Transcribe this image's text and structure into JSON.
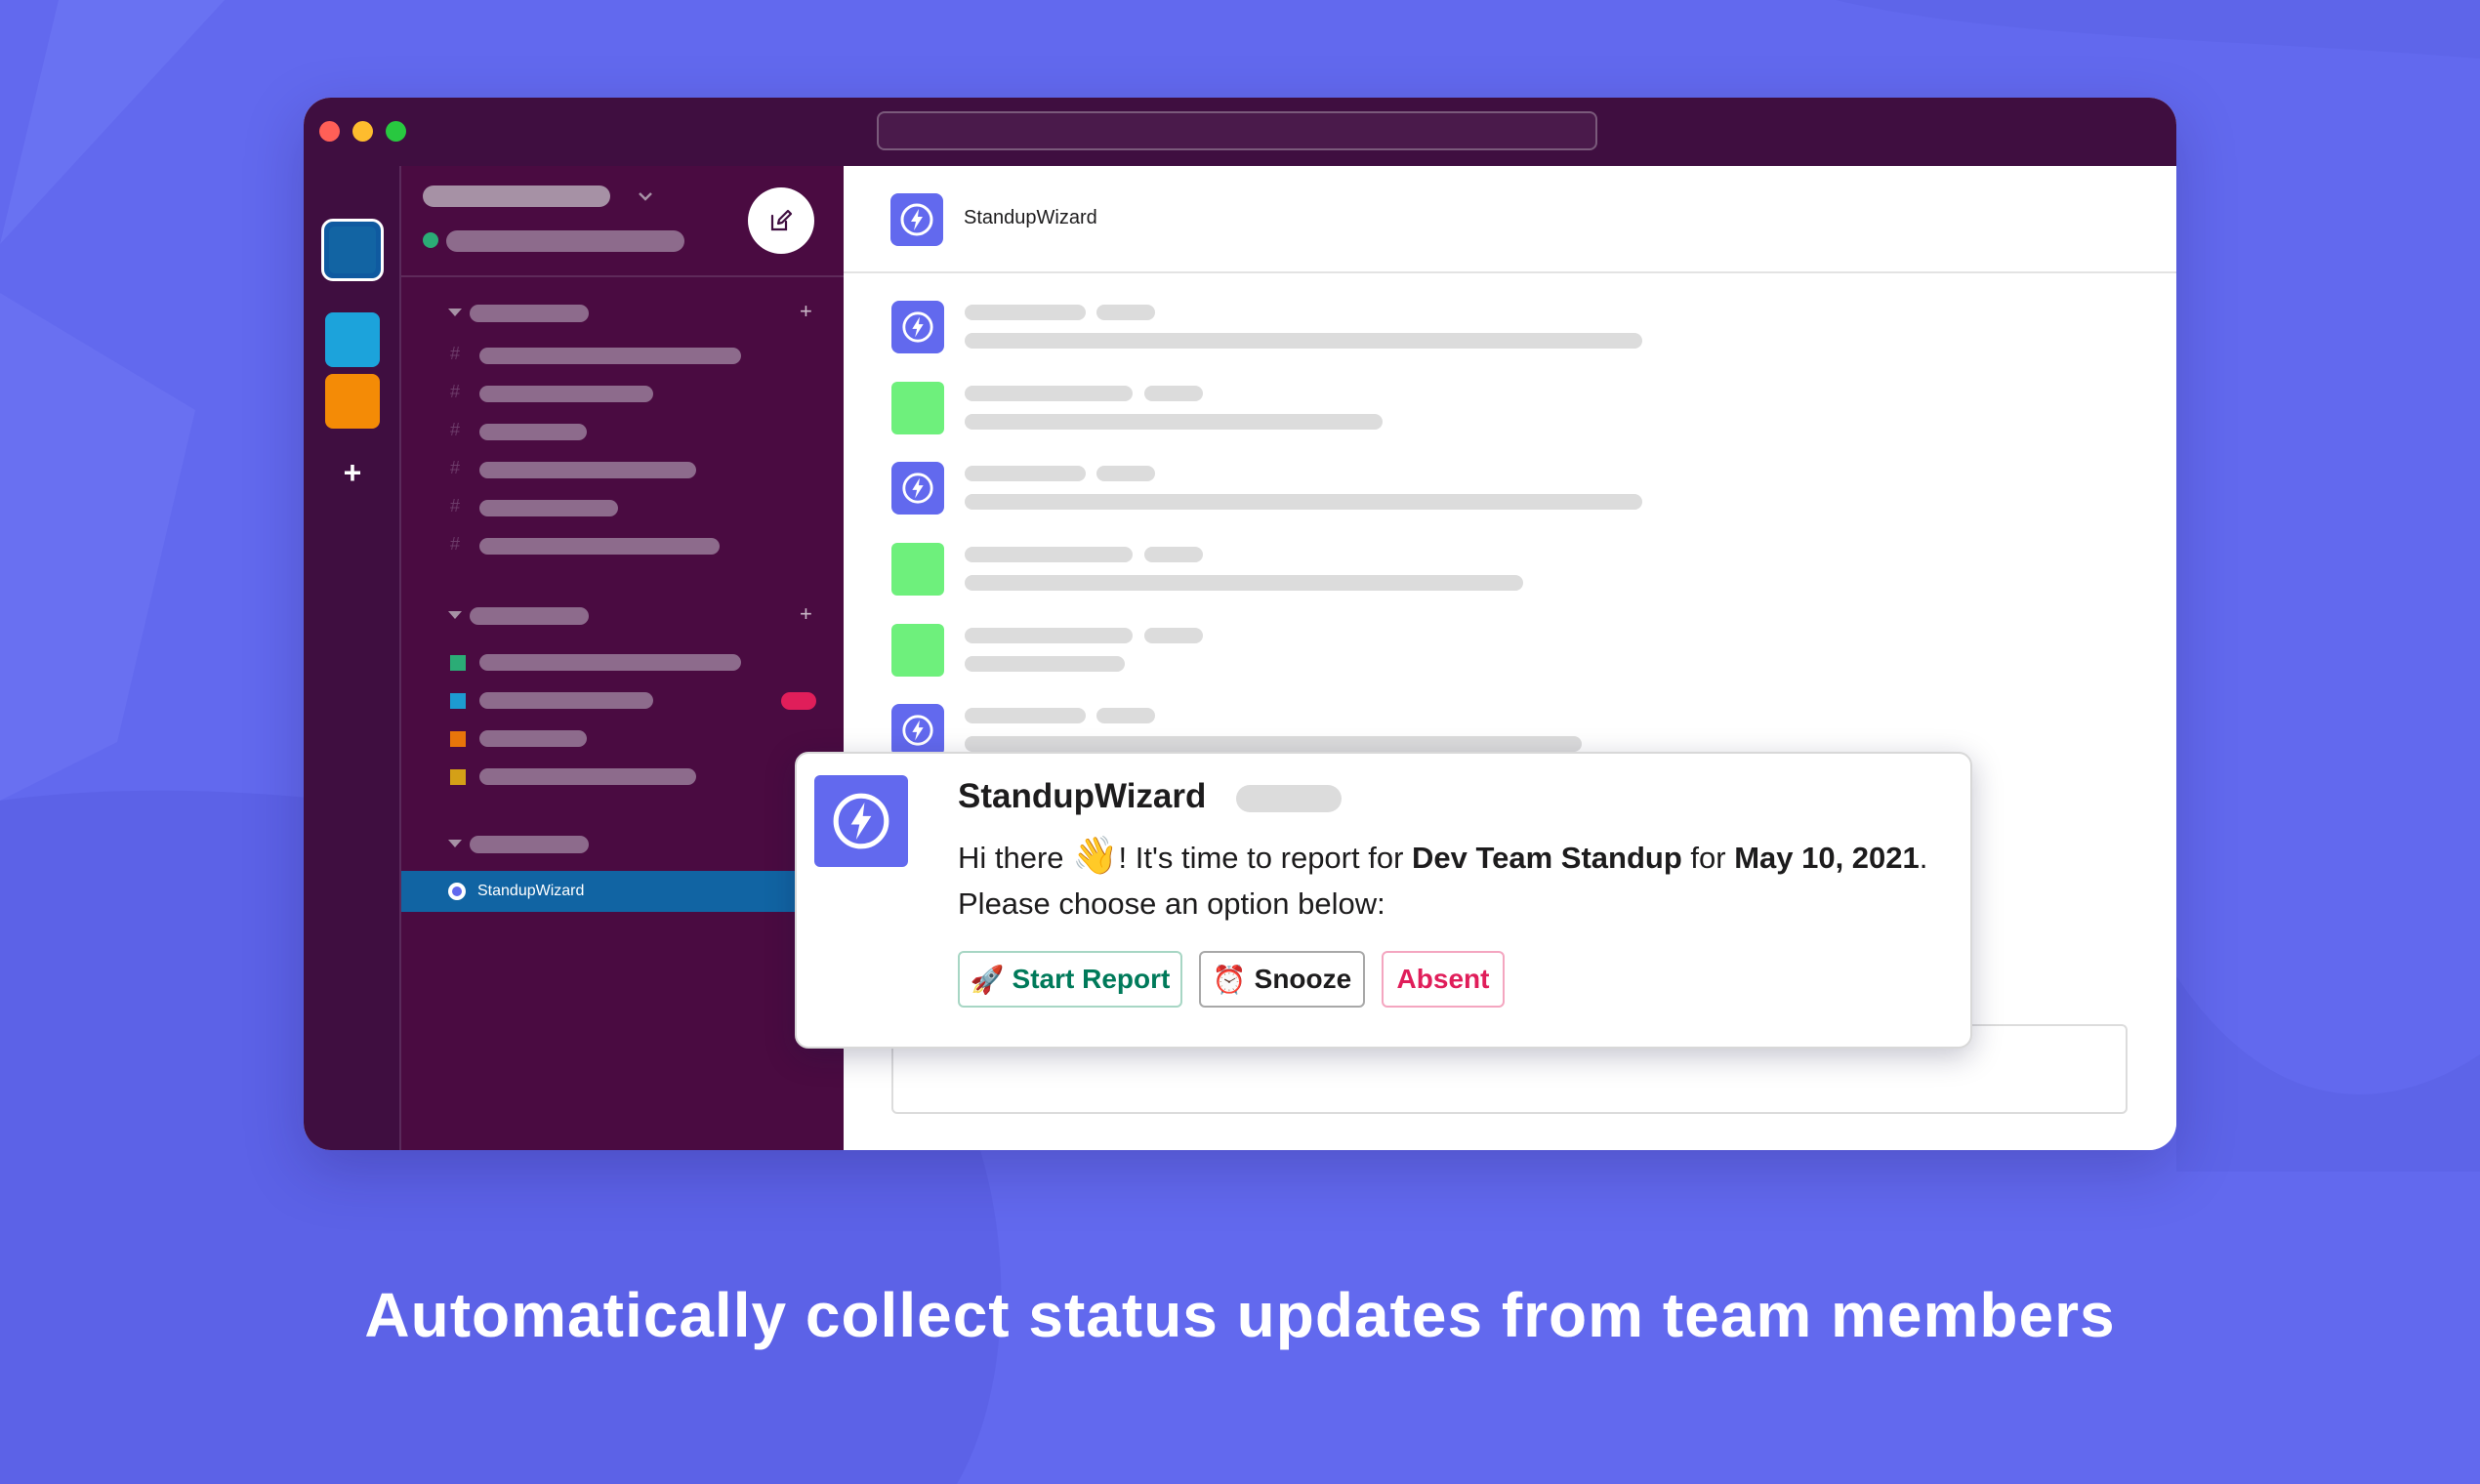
{
  "colors": {
    "background": "#6269ee",
    "window_chrome": "#3f0e40",
    "sidebar": "#4a0b41",
    "active_item": "#1164a3",
    "bot_accent": "#6269ee",
    "start_report": "#007a5a",
    "absent": "#e01e5a"
  },
  "sidebar": {
    "active_item_label": "StandupWizard"
  },
  "main": {
    "header_title": "StandupWizard"
  },
  "message": {
    "author": "StandupWizard",
    "text_greeting": "Hi there ",
    "wave_emoji": "👋",
    "text_after_emoji": "! It's time to report for ",
    "standup_name": "Dev Team Standup",
    "text_for": " for ",
    "date": "May 10, 2021",
    "text_period": ".",
    "text_line2": "Please choose an option below:",
    "buttons": {
      "start_emoji": "🚀",
      "start_label": "Start Report",
      "snooze_emoji": "⏰",
      "snooze_label": "Snooze",
      "absent_label": "Absent"
    }
  },
  "caption": "Automatically collect status updates from team members",
  "icons": {
    "bot_avatar": "lightning-bolt-icon",
    "compose": "compose-edit-icon",
    "workspace_add": "plus-icon"
  }
}
